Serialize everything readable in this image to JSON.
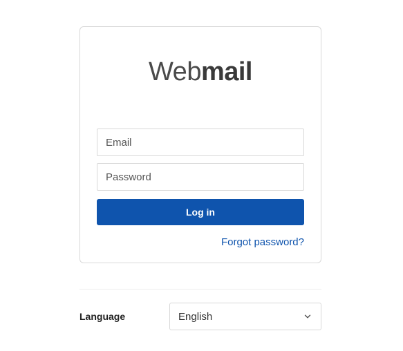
{
  "logo": {
    "light": "Web",
    "bold": "mail"
  },
  "form": {
    "email_placeholder": "Email",
    "password_placeholder": "Password",
    "login_label": "Log in",
    "forgot_label": "Forgot password?"
  },
  "language": {
    "label": "Language",
    "selected": "English"
  }
}
